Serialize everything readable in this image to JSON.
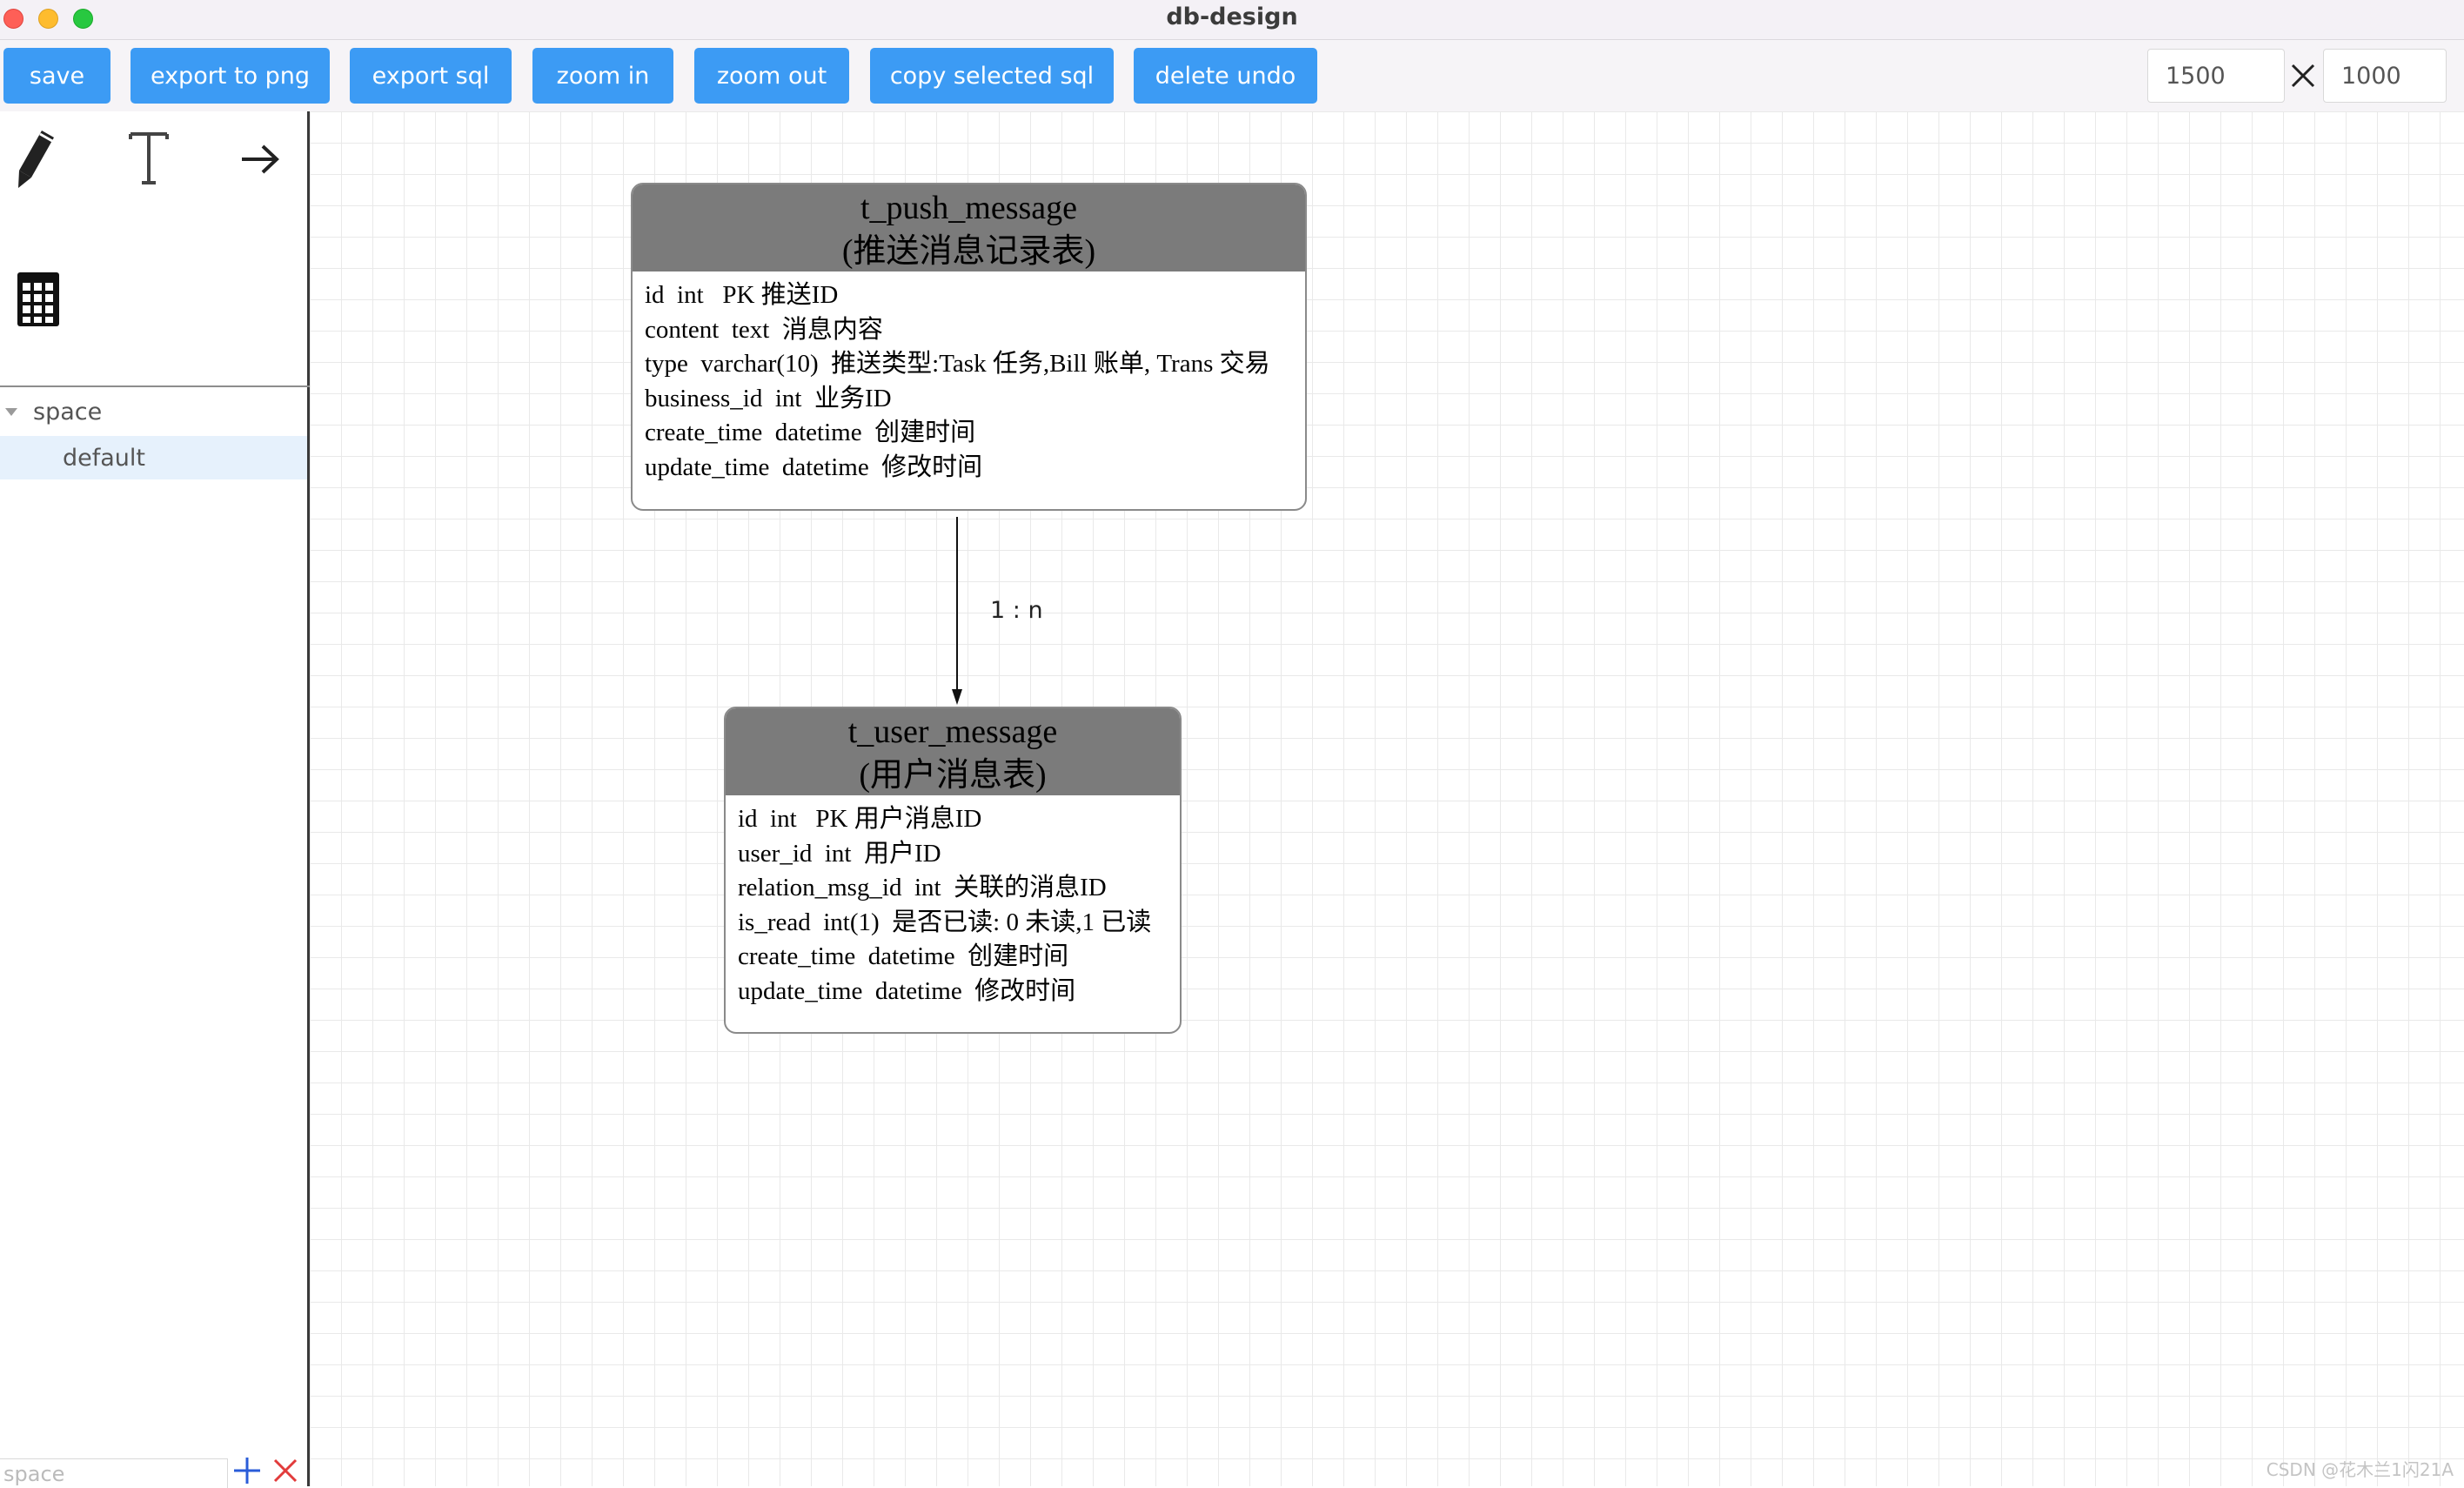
{
  "window": {
    "title": "db-design"
  },
  "toolbar": {
    "buttons": [
      {
        "label": "save"
      },
      {
        "label": "export to png"
      },
      {
        "label": "export sql"
      },
      {
        "label": "zoom in"
      },
      {
        "label": "zoom out"
      },
      {
        "label": "copy selected sql"
      },
      {
        "label": "delete undo"
      }
    ],
    "width_value": "1500",
    "height_value": "1000"
  },
  "sidebar": {
    "tools": [
      "pencil-icon",
      "text-icon",
      "arrow-icon",
      "table-icon"
    ],
    "tree": {
      "root": "space",
      "children": [
        "default"
      ]
    },
    "space_placeholder": "space"
  },
  "tables": [
    {
      "name": "t_push_message",
      "comment": "(推送消息记录表)",
      "rows": [
        "id  int   PK 推送ID",
        "content  text  消息内容",
        "type  varchar(10)  推送类型:Task 任务,Bill 账单, Trans 交易",
        "business_id  int  业务ID",
        "create_time  datetime  创建时间",
        "update_time  datetime  修改时间"
      ]
    },
    {
      "name": "t_user_message",
      "comment": "(用户消息表)",
      "rows": [
        "id  int   PK 用户消息ID",
        "user_id  int  用户ID",
        "relation_msg_id  int  关联的消息ID",
        "is_read  int(1)  是否已读: 0 未读,1 已读",
        "create_time  datetime  创建时间",
        "update_time  datetime  修改时间"
      ]
    }
  ],
  "relation": {
    "label": "1 : n"
  },
  "watermark": "CSDN @花木兰1闪21A",
  "colors": {
    "button": "#3c9bf4",
    "table_header": "#7b7b7b",
    "selected_tree_item": "#e6f1fc"
  }
}
